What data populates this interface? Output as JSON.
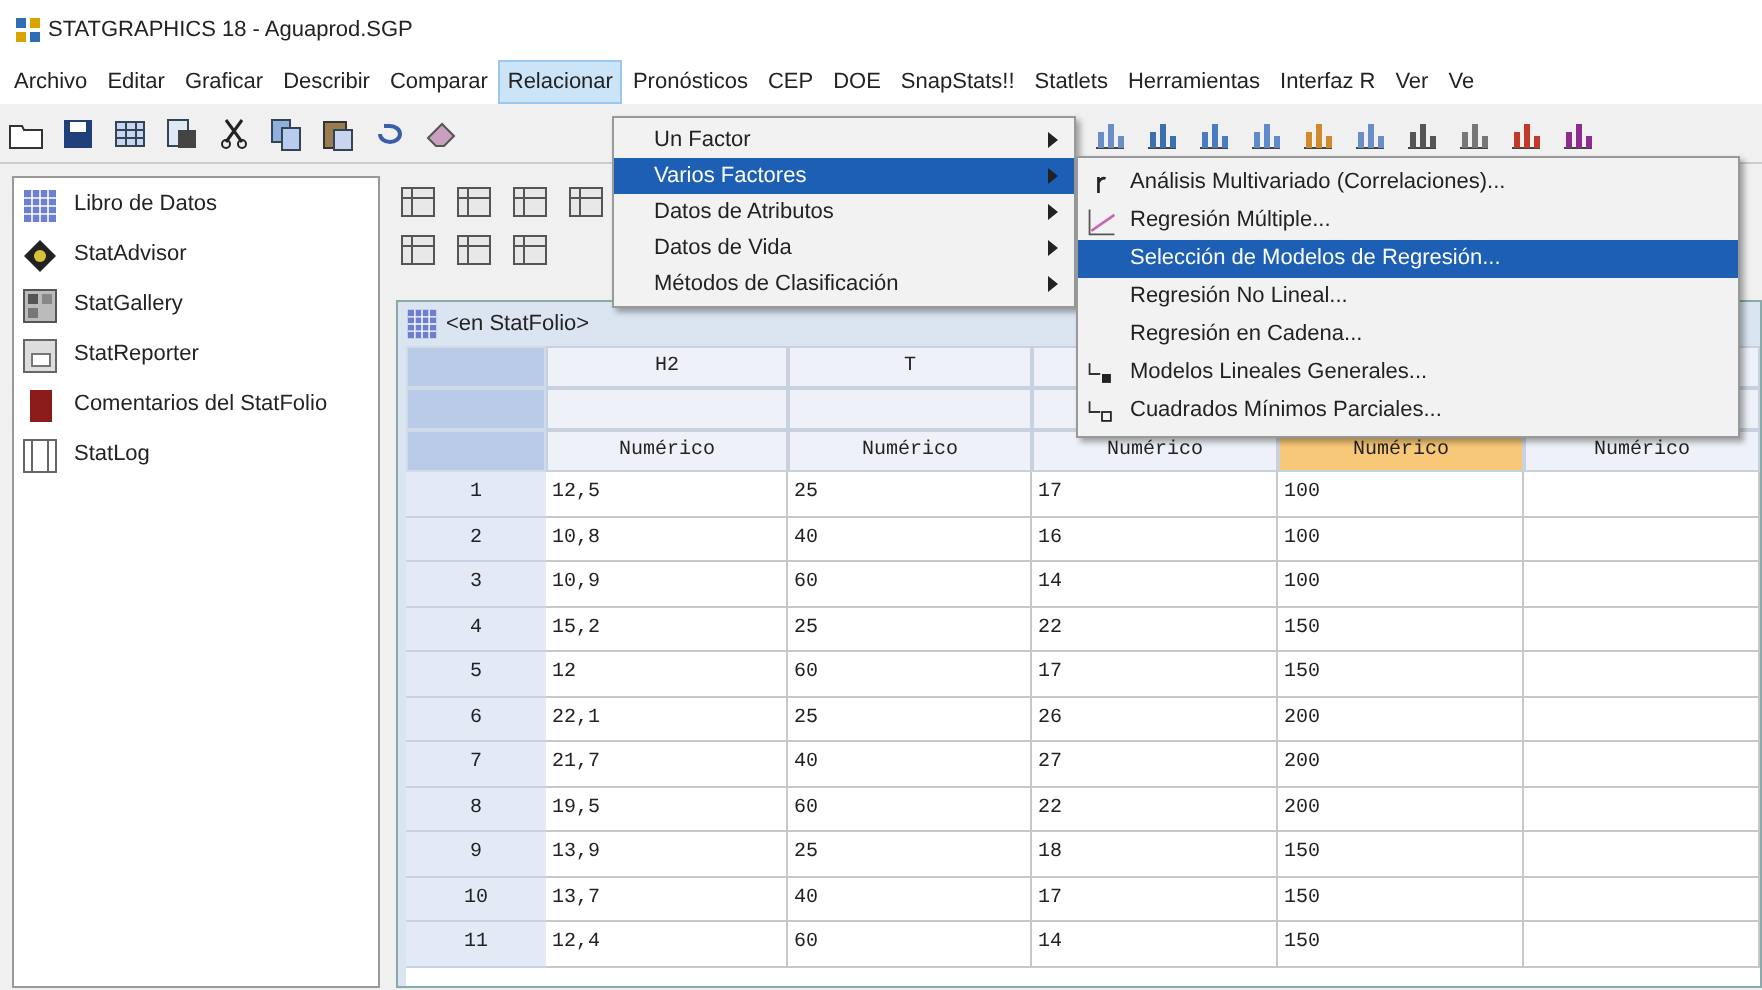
{
  "window": {
    "title": "STATGRAPHICS 18 - Aguaprod.SGP"
  },
  "menu_bar": [
    {
      "label": "Archivo",
      "selected": false
    },
    {
      "label": "Editar",
      "selected": false
    },
    {
      "label": "Graficar",
      "selected": false
    },
    {
      "label": "Describir",
      "selected": false
    },
    {
      "label": "Comparar",
      "selected": false
    },
    {
      "label": "Relacionar",
      "selected": true
    },
    {
      "label": "Pronósticos",
      "selected": false
    },
    {
      "label": "CEP",
      "selected": false
    },
    {
      "label": "DOE",
      "selected": false
    },
    {
      "label": "SnapStats!!",
      "selected": false
    },
    {
      "label": "Statlets",
      "selected": false
    },
    {
      "label": "Herramientas",
      "selected": false
    },
    {
      "label": "Interfaz R",
      "selected": false
    },
    {
      "label": "Ver",
      "selected": false
    },
    {
      "label": "Ve",
      "selected": false
    }
  ],
  "relacionar_menu": [
    {
      "label": "Un Factor",
      "selected": false
    },
    {
      "label": "Varios Factores",
      "selected": true
    },
    {
      "label": "Datos de Atributos",
      "selected": false
    },
    {
      "label": "Datos de Vida",
      "selected": false
    },
    {
      "label": "Métodos de Clasificación",
      "selected": false
    }
  ],
  "varios_factores_submenu": [
    {
      "label": "Análisis Multivariado (Correlaciones)...",
      "selected": false
    },
    {
      "label": "Regresión Múltiple...",
      "selected": false
    },
    {
      "label": "Selección de Modelos de Regresión...",
      "selected": true
    },
    {
      "label": "Regresión No Lineal...",
      "selected": false
    },
    {
      "label": "Regresión en Cadena...",
      "selected": false
    },
    {
      "label": "Modelos Lineales Generales...",
      "selected": false
    },
    {
      "label": "Cuadrados Mínimos Parciales...",
      "selected": false
    }
  ],
  "sidebar": {
    "items": [
      {
        "label": "Libro de Datos"
      },
      {
        "label": "StatAdvisor"
      },
      {
        "label": "StatGallery"
      },
      {
        "label": "StatReporter"
      },
      {
        "label": "Comentarios del StatFolio"
      },
      {
        "label": "StatLog"
      }
    ]
  },
  "data_window": {
    "title": "<en StatFolio>",
    "columns": [
      {
        "name": "H2",
        "type": "Numérico",
        "selected": false
      },
      {
        "name": "T",
        "type": "Numérico",
        "selected": false
      },
      {
        "type": "Numérico",
        "selected": false
      },
      {
        "type": "Numérico",
        "selected": true
      },
      {
        "type": "Numérico",
        "selected": false
      }
    ],
    "rows": [
      {
        "number": "1",
        "cells": [
          "12,5",
          "25",
          "17",
          "100"
        ]
      },
      {
        "number": "2",
        "cells": [
          "10,8",
          "40",
          "16",
          "100"
        ]
      },
      {
        "number": "3",
        "cells": [
          "10,9",
          "60",
          "14",
          "100"
        ]
      },
      {
        "number": "4",
        "cells": [
          "15,2",
          "25",
          "22",
          "150"
        ]
      },
      {
        "number": "5",
        "cells": [
          "12",
          "60",
          "17",
          "150"
        ]
      },
      {
        "number": "6",
        "cells": [
          "22,1",
          "25",
          "26",
          "200"
        ]
      },
      {
        "number": "7",
        "cells": [
          "21,7",
          "40",
          "27",
          "200"
        ]
      },
      {
        "number": "8",
        "cells": [
          "19,5",
          "60",
          "22",
          "200"
        ]
      },
      {
        "number": "9",
        "cells": [
          "13,9",
          "25",
          "18",
          "150"
        ]
      },
      {
        "number": "10",
        "cells": [
          "13,7",
          "40",
          "17",
          "150"
        ]
      },
      {
        "number": "11",
        "cells": [
          "12,4",
          "60",
          "14",
          "150"
        ]
      }
    ]
  }
}
